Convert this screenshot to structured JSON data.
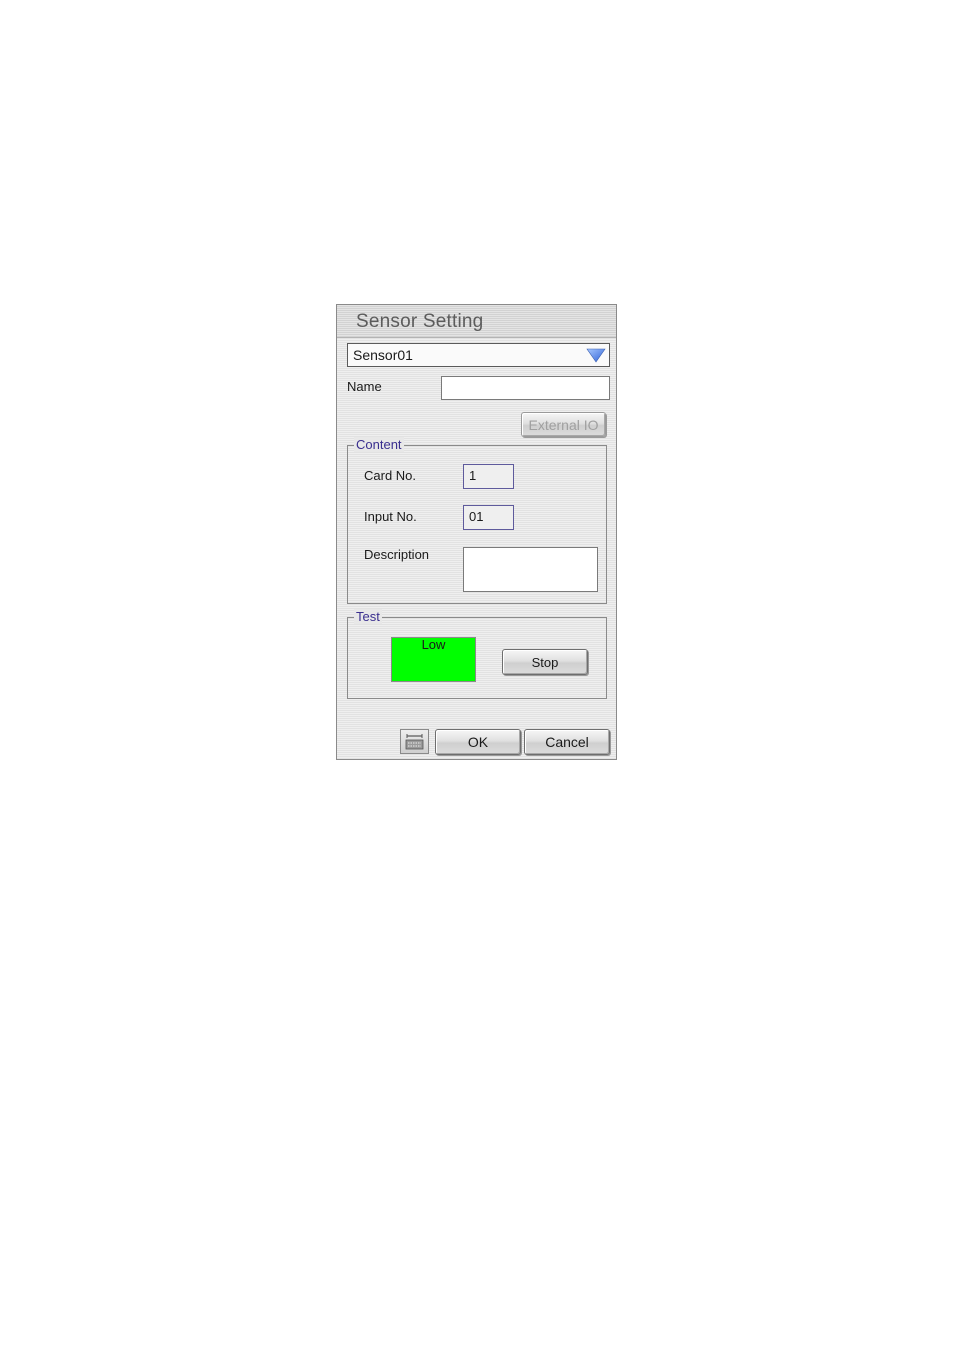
{
  "dialog": {
    "title": "Sensor Setting",
    "sensor_select": {
      "value": "Sensor01",
      "icon": "dropdown-arrow-icon"
    },
    "name_label": "Name",
    "name_value": "",
    "external_io_label": "External IO",
    "content": {
      "legend": "Content",
      "card_no_label": "Card No.",
      "card_no_value": "1",
      "input_no_label": "Input No.",
      "input_no_value": "01",
      "description_label": "Description",
      "description_value": ""
    },
    "test": {
      "legend": "Test",
      "status_text": "Low",
      "status_color": "#00ff00",
      "stop_label": "Stop"
    },
    "footer": {
      "keyboard_icon": "keyboard-icon",
      "ok_label": "OK",
      "cancel_label": "Cancel"
    }
  }
}
